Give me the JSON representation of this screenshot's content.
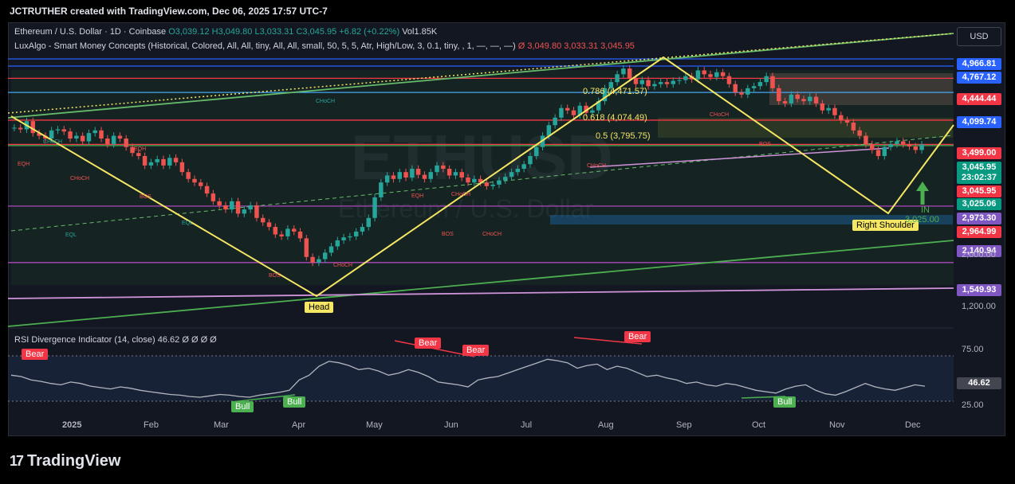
{
  "header": {
    "title": "JCTRUTHER created with TradingView.com, Dec 06, 2025 17:57 UTC-7"
  },
  "legend": {
    "symbol": "Ethereum / U.S. Dollar · 1D · Coinbase",
    "open": "O3,039.12",
    "high": "H3,049.80",
    "low": "L3,033.31",
    "close": "C3,045.95",
    "change": "+6.82 (+0.22%)",
    "volume": "Vol1.85K",
    "indicator": "LuxAlgo - Smart Money Concepts (Historical, Colored, All, All, tiny, All, All, small, 50, 5, 5, Atr, High/Low, 3, 0.1, tiny, , 1, —, —, —)",
    "indicator_vals": "Ø  3,049.80  3,033.31  3,045.95",
    "rsi": "RSI Divergence Indicator (14, close)",
    "rsi_val": "46.62",
    "rsi_vals": "Ø Ø Ø Ø"
  },
  "watermark": {
    "symbol": "ETHUSD",
    "name": "Ethereum / U.S. Dollar"
  },
  "currency_button": "USD",
  "branding": {
    "logo": "TradingView"
  },
  "colors": {
    "up": "#26a69a",
    "down": "#ef5350",
    "trend": "#f5e663",
    "green_line": "#4caf50",
    "purple_line": "#b388ff",
    "blue_line": "#2962ff"
  },
  "chart_data": {
    "type": "candlestick",
    "symbol": "ETHUSD",
    "timeframe": "1D",
    "x_ticks": [
      "2025",
      "Feb",
      "Mar",
      "Apr",
      "May",
      "Jun",
      "Jul",
      "Aug",
      "Sep",
      "Oct",
      "Nov",
      "Dec"
    ],
    "y_ticks": [
      "2,000.00",
      "1,200.00"
    ],
    "price_levels": [
      {
        "value": "4,966.81",
        "color": "#2962ff",
        "text": "#ffffff"
      },
      {
        "value": "4,767.12",
        "color": "#2962ff",
        "text": "#ffffff"
      },
      {
        "value": "4,444.44",
        "color": "#f23645",
        "text": "#ffffff"
      },
      {
        "value": "4,099.74",
        "color": "#2962ff",
        "text": "#ffffff"
      },
      {
        "value": "3,499.00",
        "color": "#f23645",
        "text": "#ffffff"
      },
      {
        "value": "3,045.95",
        "color": "#089981",
        "text": "#ffffff"
      },
      {
        "value": "23:02:37",
        "color": "#089981",
        "text": "#ffffff"
      },
      {
        "value": "3,045.95",
        "color": "#f23645",
        "text": "#ffffff"
      },
      {
        "value": "3,025.06",
        "color": "#089981",
        "text": "#ffffff"
      },
      {
        "value": "2,973.30",
        "color": "#7e57c2",
        "text": "#ffffff"
      },
      {
        "value": "2,964.99",
        "color": "#f23645",
        "text": "#ffffff"
      },
      {
        "value": "2,140.94",
        "color": "#7e57c2",
        "text": "#ffffff"
      },
      {
        "value": "1,549.93",
        "color": "#7e57c2",
        "text": "#ffffff"
      }
    ],
    "fib_labels": [
      "0.786 (4,471.57)",
      "0.618 (4,074.49)",
      "0.5 (3,795.75)"
    ],
    "annotations": [
      "Head",
      "Right Shoulder",
      "IN",
      "3,025.00"
    ],
    "smc_labels": [
      "CHoCH",
      "CHoCH",
      "EQH",
      "EQH",
      "CHoCH",
      "BOS",
      "EQL",
      "EQL",
      "BOS",
      "CHoCH",
      "EQH",
      "CHoCH",
      "BOS",
      "CHoCH",
      "CHoCH",
      "CHoCH",
      "BOS"
    ],
    "closes": [
      3350,
      3320,
      3480,
      3250,
      3200,
      3150,
      3300,
      3320,
      3280,
      3150,
      3200,
      3100,
      3250,
      3300,
      3150,
      3050,
      3200,
      3150,
      3000,
      2900,
      2850,
      2700,
      2750,
      2800,
      2700,
      2820,
      2750,
      2600,
      2500,
      2450,
      2400,
      2300,
      2200,
      2150,
      2100,
      2200,
      2050,
      2100,
      2150,
      2000,
      1950,
      1900,
      1820,
      1800,
      1880,
      1850,
      1780,
      1600,
      1550,
      1580,
      1640,
      1700,
      1760,
      1790,
      1800,
      1850,
      1900,
      2000,
      2250,
      2450,
      2550,
      2500,
      2600,
      2520,
      2650,
      2560,
      2500,
      2600,
      2700,
      2650,
      2550,
      2600,
      2520,
      2450,
      2500,
      2450,
      2400,
      2420,
      2480,
      2530,
      2600,
      2650,
      2720,
      2850,
      3000,
      3200,
      3400,
      3550,
      3750,
      3700,
      3600,
      3800,
      3650,
      3700,
      3900,
      4200,
      4350,
      4550,
      4700,
      4450,
      4300,
      4400,
      4250,
      4300,
      4350,
      4300,
      4380,
      4400,
      4500,
      4420,
      4650,
      4550,
      4480,
      4600,
      4500,
      4300,
      4100,
      4050,
      4200,
      4250,
      4350,
      4500,
      4200,
      3900,
      3850,
      4050,
      3950,
      3900,
      4000,
      3850,
      3700,
      3750,
      3600,
      3500,
      3450,
      3300,
      3200,
      3050,
      2950,
      2850,
      3000,
      3050,
      3100,
      3050,
      3010,
      2950,
      3046
    ],
    "rsi": {
      "title": "RSI Divergence Indicator (14, close)",
      "y_ticks": [
        "75.00",
        "25.00"
      ],
      "value": "46.62",
      "values": [
        62,
        60,
        55,
        53,
        50,
        48,
        52,
        50,
        46,
        44,
        42,
        45,
        43,
        40,
        38,
        36,
        34,
        33,
        31,
        30,
        32,
        34,
        33,
        31,
        30,
        33,
        35,
        37,
        40,
        55,
        62,
        75,
        82,
        80,
        76,
        70,
        72,
        68,
        62,
        65,
        70,
        66,
        60,
        52,
        50,
        48,
        45,
        55,
        58,
        60,
        65,
        70,
        75,
        80,
        85,
        83,
        80,
        72,
        76,
        78,
        70,
        75,
        72,
        66,
        60,
        62,
        58,
        55,
        50,
        52,
        48,
        46,
        50,
        48,
        44,
        40,
        38,
        36,
        42,
        46,
        48,
        40,
        35,
        33,
        38,
        44,
        50,
        45,
        42,
        40,
        44,
        48,
        46
      ],
      "labels": [
        {
          "text": "Bear",
          "type": "bear"
        },
        {
          "text": "Bull",
          "type": "bull"
        },
        {
          "text": "Bull",
          "type": "bull"
        },
        {
          "text": "Bear",
          "type": "bear"
        },
        {
          "text": "Bear",
          "type": "bear"
        },
        {
          "text": "Bear",
          "type": "bear"
        },
        {
          "text": "Bull",
          "type": "bull"
        }
      ]
    }
  }
}
